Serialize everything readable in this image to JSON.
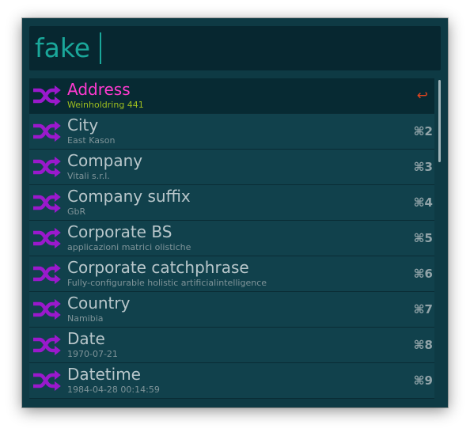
{
  "colors": {
    "window_bg": "#0e3a44",
    "search_bg": "#072730",
    "search_text": "#1aa79a",
    "selected_title": "#ff3ad0",
    "selected_subtitle": "#9dbd1f",
    "icon": "#9a19cc",
    "return_glyph": "#e0441f"
  },
  "search": {
    "query": "fake"
  },
  "results": [
    {
      "title": "Address",
      "subtitle": "Weinholdring 441",
      "shortcut": "↩",
      "icon": "shuffle-icon",
      "selected": true
    },
    {
      "title": "City",
      "subtitle": "East Kason",
      "shortcut": "⌘2",
      "icon": "shuffle-icon"
    },
    {
      "title": "Company",
      "subtitle": "Vitali s.r.l.",
      "shortcut": "⌘3",
      "icon": "shuffle-icon"
    },
    {
      "title": "Company suffix",
      "subtitle": "GbR",
      "shortcut": "⌘4",
      "icon": "shuffle-icon"
    },
    {
      "title": "Corporate BS",
      "subtitle": "applicazioni matrici olistiche",
      "shortcut": "⌘5",
      "icon": "shuffle-icon"
    },
    {
      "title": "Corporate catchphrase",
      "subtitle": "Fully-configurable holistic artificialintelligence",
      "shortcut": "⌘6",
      "icon": "shuffle-icon"
    },
    {
      "title": "Country",
      "subtitle": "Namibia",
      "shortcut": "⌘7",
      "icon": "shuffle-icon"
    },
    {
      "title": "Date",
      "subtitle": "1970-07-21",
      "shortcut": "⌘8",
      "icon": "shuffle-icon"
    },
    {
      "title": "Datetime",
      "subtitle": "1984-04-28 00:14:59",
      "shortcut": "⌘9",
      "icon": "shuffle-icon"
    }
  ]
}
